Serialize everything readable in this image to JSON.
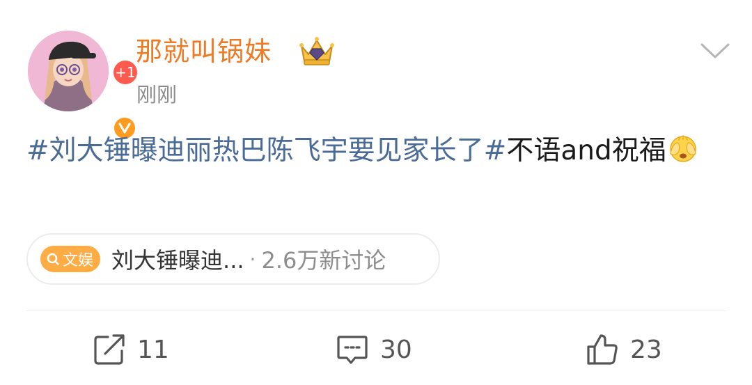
{
  "post": {
    "author": {
      "name": "那就叫锅妹",
      "notification_badge": "+1",
      "verified_icon": "verified-v-icon",
      "crown_icon": "crown-icon",
      "accent_color": "#ef7a23"
    },
    "timestamp": "刚刚",
    "content": {
      "hashtag": "#刘大锤曝迪丽热巴陈飞宇要见家长了#",
      "text": "不语and祝福",
      "emoji": "face-covering-eyes-emoji"
    },
    "topic_card": {
      "tag_icon": "search-icon",
      "tag_label": "文娱",
      "title": "刘大锤曝迪...",
      "separator": "·",
      "count": "2.6万新讨论"
    },
    "actions": {
      "share": {
        "icon": "share-icon",
        "count": "11"
      },
      "comment": {
        "icon": "comment-icon",
        "count": "30"
      },
      "like": {
        "icon": "thumbs-up-icon",
        "count": "23"
      }
    },
    "menu_icon": "chevron-down-icon",
    "colors": {
      "hashtag": "#4a6b96",
      "topic_tag_bg": "#ffac45",
      "badge_red": "#ff5a4e",
      "verified_orange": "#ff9c20"
    }
  }
}
